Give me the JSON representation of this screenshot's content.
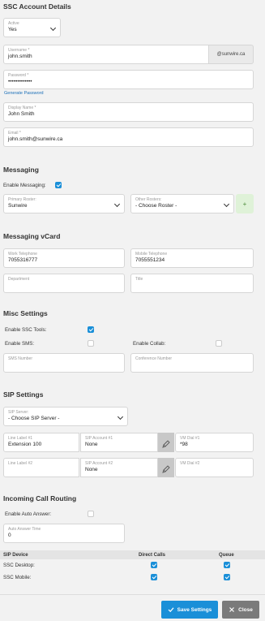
{
  "account": {
    "title": "SSC Account Details",
    "active_label": "Active",
    "active_value": "Yes",
    "username_label": "Username *",
    "username_value": "john.smith",
    "domain": "@sunwire.ca",
    "password_label": "Password *",
    "password_value": "•••••••••••••",
    "generate_password": "Generate Password",
    "display_name_label": "Display Name *",
    "display_name_value": "John Smith",
    "email_label": "Email *",
    "email_value": "john.smith@sunwire.ca"
  },
  "messaging": {
    "title": "Messaging",
    "enable_label": "Enable Messaging:",
    "enabled": true,
    "primary_roster_label": "Primary Roster:",
    "primary_roster_value": "Sunwire",
    "other_rosters_label": "Other Rosters:",
    "other_rosters_value": "- Choose Roster -",
    "add_label": "+"
  },
  "vcard": {
    "title": "Messaging vCard",
    "work_tel_label": "Work Telephone",
    "work_tel_value": "7055316777",
    "mobile_tel_label": "Mobile Telephone",
    "mobile_tel_value": "7055551234",
    "department_label": "Department",
    "title_label": "Title"
  },
  "misc": {
    "title": "Misc Settings",
    "enable_ssc_tools_label": "Enable SSC Tools:",
    "enable_ssc_tools": true,
    "enable_sms_label": "Enable SMS:",
    "enable_sms": false,
    "enable_collab_label": "Enable Collab:",
    "enable_collab": false,
    "sms_number_label": "SMS Number",
    "conference_number_label": "Conference Number"
  },
  "sip": {
    "title": "SIP Settings",
    "server_label": "SIP Server:",
    "server_value": "- Choose SIP Server -",
    "line1_label": "Line Label #1",
    "line1_value": "Extension 100",
    "account1_label": "SIP Account #1",
    "account1_value": "None",
    "vm1_label": "VM Dial #1",
    "vm1_value": "*98",
    "line2_label": "Line Label #2",
    "account2_label": "SIP Account #2",
    "account2_value": "None",
    "vm2_label": "VM Dial #2"
  },
  "routing": {
    "title": "Incoming Call Routing",
    "auto_answer_label": "Enable Auto Answer:",
    "auto_answer": false,
    "auto_answer_time_label": "Auto Answer Time",
    "auto_answer_time_value": "0",
    "table_headers": [
      "SIP Device",
      "Direct Calls",
      "Queue"
    ],
    "rows": [
      {
        "device": "SSC Desktop:",
        "direct": true,
        "queue": true
      },
      {
        "device": "SSC Mobile:",
        "direct": true,
        "queue": true
      }
    ]
  },
  "footer": {
    "save_label": "Save Settings",
    "close_label": "Close"
  },
  "colors": {
    "accent": "#1a8fd8",
    "background": "#f2f2f2",
    "close_button": "#7a7a7a"
  }
}
